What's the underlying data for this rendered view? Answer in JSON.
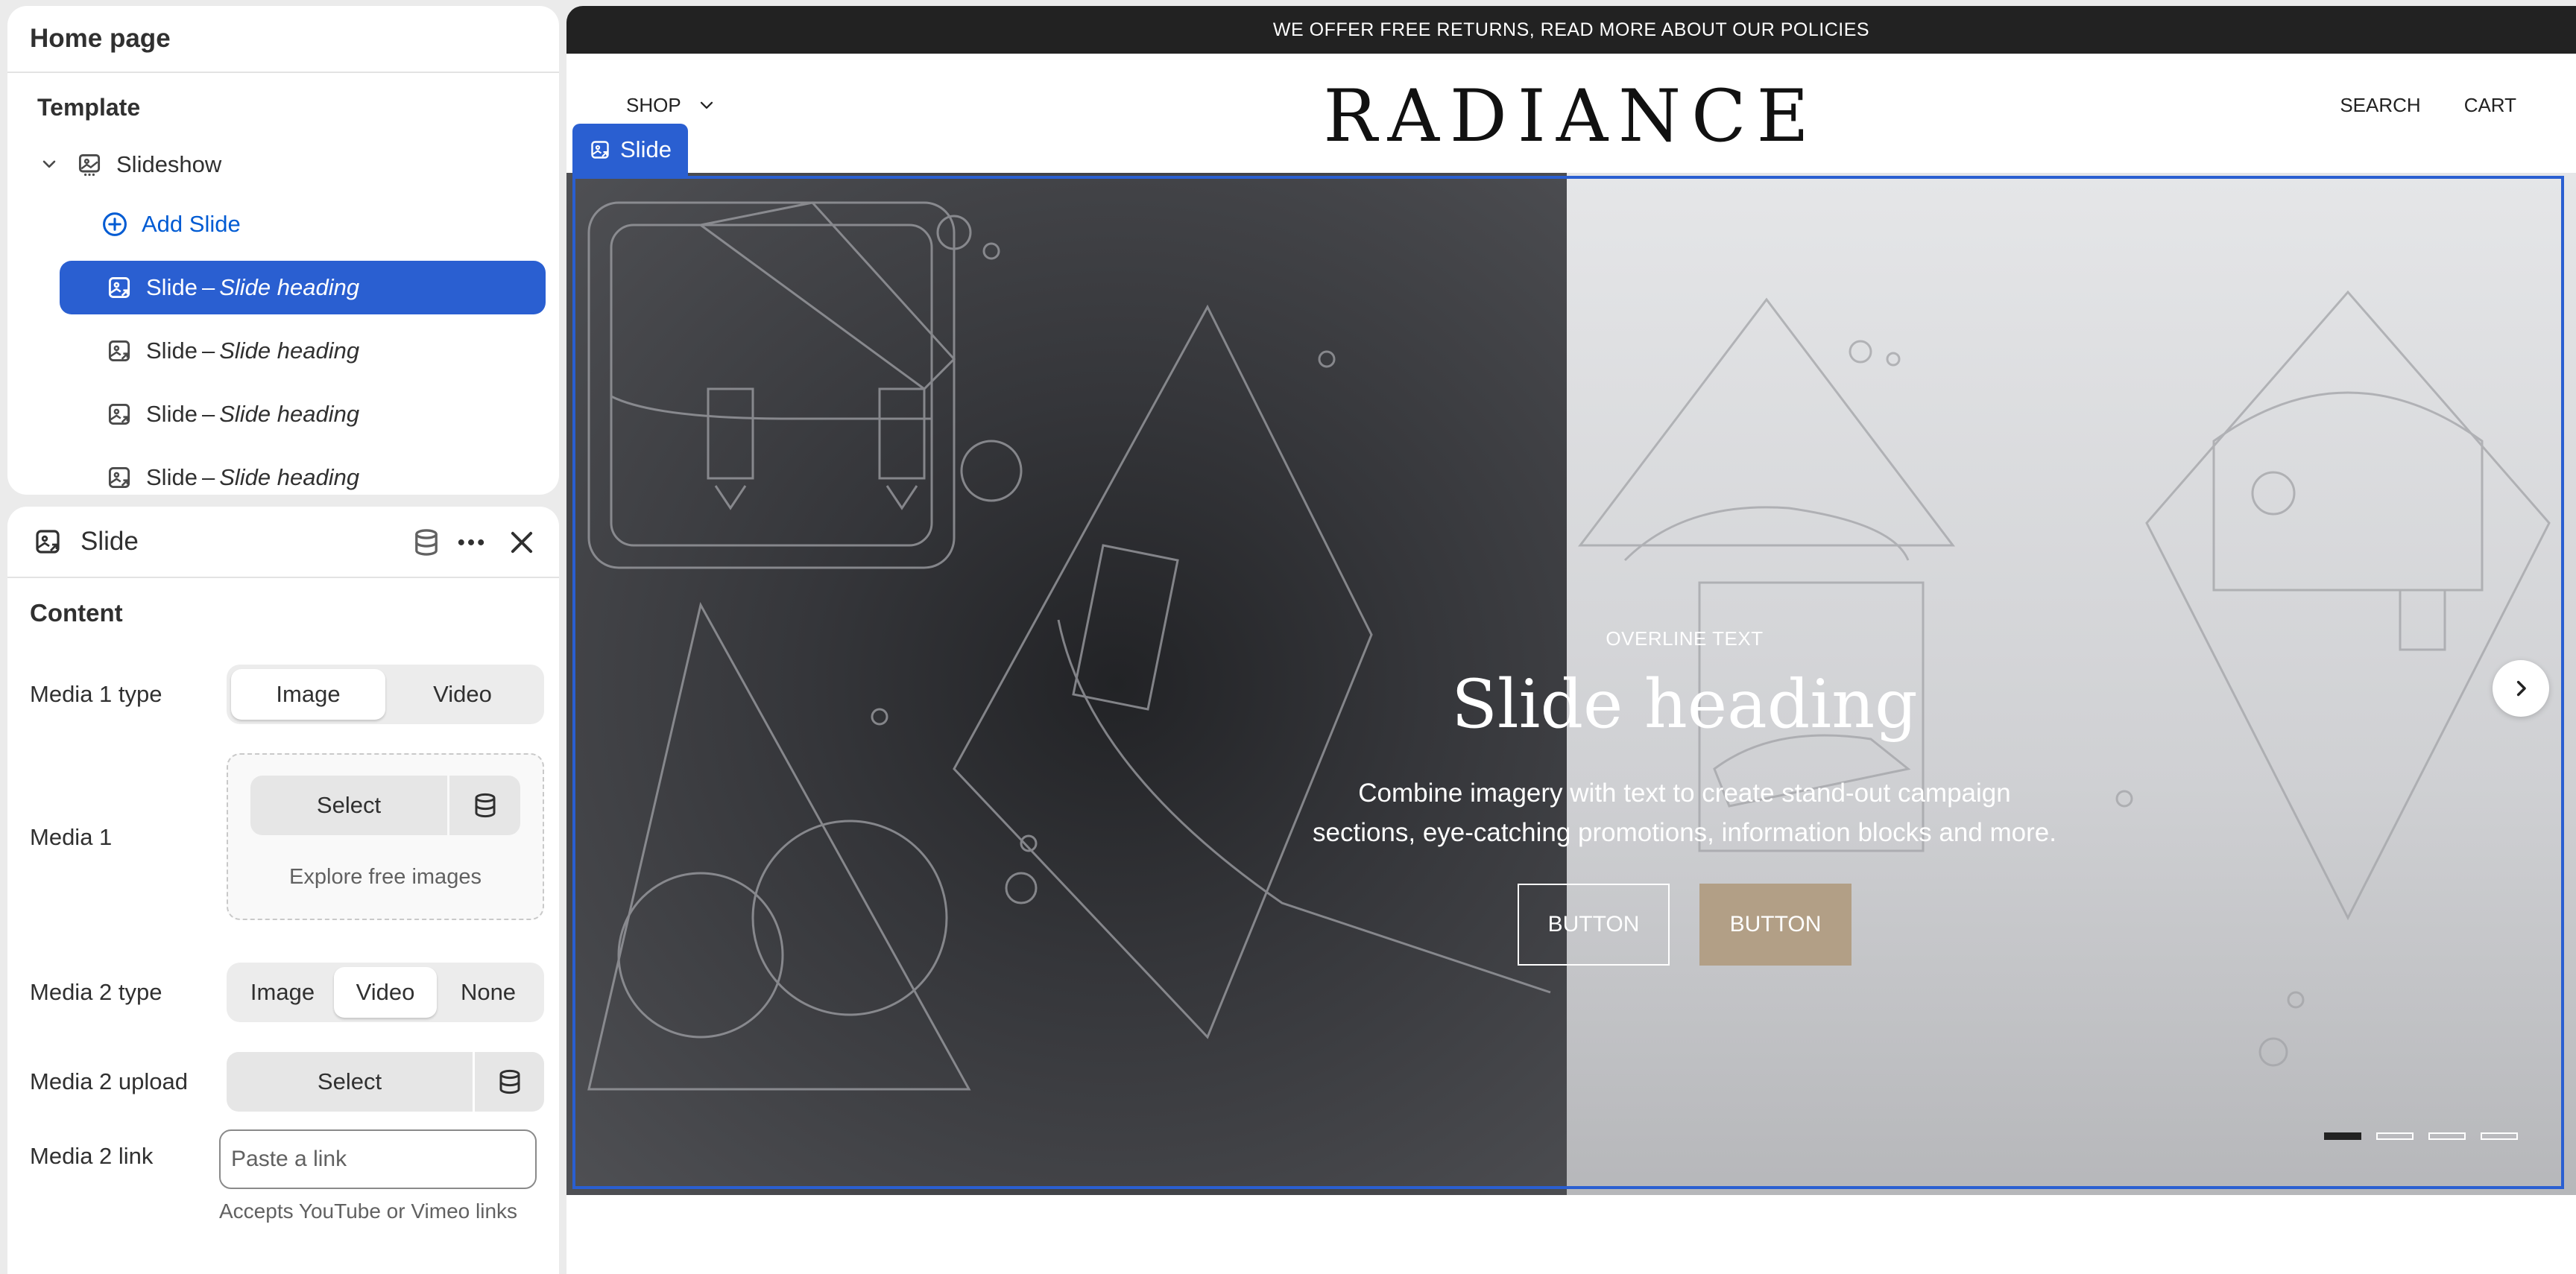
{
  "sidebar": {
    "page_title": "Home page",
    "section_title": "Template",
    "slideshow_label": "Slideshow",
    "add_slide_label": "Add Slide",
    "slides": [
      {
        "name": "Slide",
        "separator": "–",
        "heading": "Slide heading",
        "selected": true
      },
      {
        "name": "Slide",
        "separator": "–",
        "heading": "Slide heading",
        "selected": false
      },
      {
        "name": "Slide",
        "separator": "–",
        "heading": "Slide heading",
        "selected": false
      },
      {
        "name": "Slide",
        "separator": "–",
        "heading": "Slide heading",
        "selected": false
      }
    ]
  },
  "settings": {
    "title": "Slide",
    "content_title": "Content",
    "media1_type": {
      "label": "Media 1 type",
      "options": [
        "Image",
        "Video"
      ],
      "selected": "Image"
    },
    "media1": {
      "label": "Media 1",
      "select_label": "Select",
      "explore_label": "Explore free images"
    },
    "media2_type": {
      "label": "Media 2 type",
      "options": [
        "Image",
        "Video",
        "None"
      ],
      "selected": "Video"
    },
    "media2_upload": {
      "label": "Media 2 upload",
      "select_label": "Select"
    },
    "media2_link": {
      "label": "Media 2 link",
      "placeholder": "Paste a link",
      "value": "",
      "helper": "Accepts YouTube or Vimeo links"
    }
  },
  "preview": {
    "announcement": "WE OFFER FREE RETURNS, READ MORE ABOUT OUR POLICIES",
    "nav_shop": "SHOP",
    "logo": "RADIANCE",
    "nav_search": "SEARCH",
    "nav_cart": "CART",
    "selection_tag": "Slide",
    "hero": {
      "overline": "OVERLINE TEXT",
      "heading": "Slide heading",
      "description": "Combine imagery with text to create stand-out campaign sections, eye-catching promotions, information blocks and more.",
      "button1": "BUTTON",
      "button2": "BUTTON"
    },
    "pagination": {
      "total": 4,
      "active": 1
    }
  },
  "colors": {
    "accent": "#2a5fd1",
    "link": "#005bd3",
    "button_filled": "#b29f86",
    "announcement_bg": "#222222"
  },
  "icons": [
    "chevron-down-icon",
    "slideshow-icon",
    "plus-circle-icon",
    "slide-image-icon",
    "stack-icon",
    "more-icon",
    "close-icon",
    "chevron-right-icon"
  ]
}
